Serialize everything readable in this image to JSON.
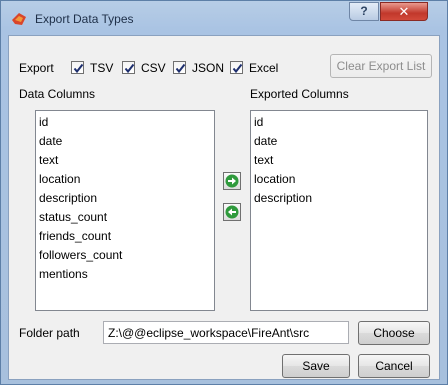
{
  "window": {
    "title": "Export Data Types",
    "help_label": "?",
    "close_label": "✕"
  },
  "export": {
    "label": "Export",
    "formats": [
      {
        "label": "TSV",
        "checked": true
      },
      {
        "label": "CSV",
        "checked": true
      },
      {
        "label": "JSON",
        "checked": true
      },
      {
        "label": "Excel",
        "checked": true
      }
    ],
    "clear_label": "Clear Export List"
  },
  "data_columns": {
    "title": "Data Columns",
    "items": [
      "id",
      "date",
      "text",
      "location",
      "description",
      "status_count",
      "friends_count",
      "followers_count",
      "mentions"
    ]
  },
  "exported_columns": {
    "title": "Exported Columns",
    "items": [
      "id",
      "date",
      "text",
      "location",
      "description"
    ]
  },
  "folder": {
    "label": "Folder path",
    "value": "Z:\\@@eclipse_workspace\\FireAnt\\src",
    "choose_label": "Choose"
  },
  "footer": {
    "save_label": "Save",
    "cancel_label": "Cancel"
  },
  "colors": {
    "arrow_green": "#2f9a3c",
    "title_red": "#c1382b"
  }
}
